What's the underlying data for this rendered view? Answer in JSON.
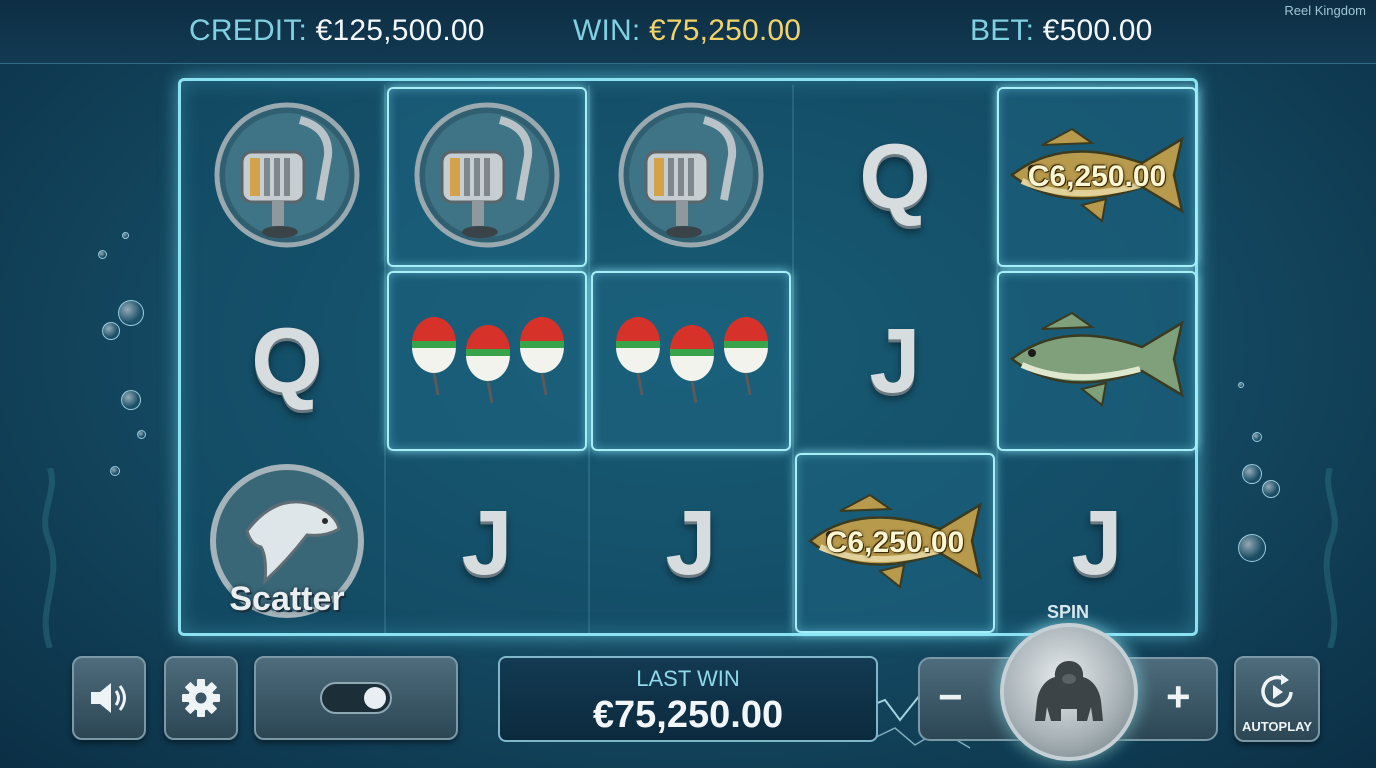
{
  "header": {
    "credit_label": "CREDIT:",
    "credit_value": "€125,500.00",
    "win_label": "WIN:",
    "win_value": "€75,250.00",
    "bet_label": "BET:",
    "bet_value": "€500.00",
    "brand": "Reel Kingdom"
  },
  "reels": [
    [
      {
        "symbol": "reel-icon"
      },
      {
        "symbol": "letter",
        "text": "Q"
      },
      {
        "symbol": "scatter-icon",
        "text": "Scatter"
      }
    ],
    [
      {
        "symbol": "reel-icon",
        "highlight": true
      },
      {
        "symbol": "bobbers-icon",
        "highlight": true
      },
      {
        "symbol": "letter",
        "text": "J"
      }
    ],
    [
      {
        "symbol": "reel-icon"
      },
      {
        "symbol": "bobbers-icon",
        "highlight": true
      },
      {
        "symbol": "letter",
        "text": "J"
      }
    ],
    [
      {
        "symbol": "letter",
        "text": "Q"
      },
      {
        "symbol": "letter",
        "text": "J"
      },
      {
        "symbol": "fish-gold-icon",
        "text": "C6,250.00",
        "highlight": true
      }
    ],
    [
      {
        "symbol": "fish-gold-icon",
        "text": "C6,250.00",
        "highlight": true
      },
      {
        "symbol": "fish-green-icon",
        "highlight": true
      },
      {
        "symbol": "letter",
        "text": "J"
      }
    ]
  ],
  "controls": {
    "sound_icon": "speaker-icon",
    "settings_icon": "gear-icon",
    "toggle_state": "on",
    "last_win_label": "LAST WIN",
    "last_win_value": "€75,250.00",
    "spin_label": "SPIN",
    "spin_icon": "gorilla-icon",
    "minus_label": "−",
    "plus_label": "+",
    "autoplay_label": "AUTOPLAY",
    "autoplay_icon": "autoplay-icon"
  },
  "colors": {
    "accent": "#8be3f2",
    "win": "#f2d36a",
    "background": "#154d66"
  }
}
